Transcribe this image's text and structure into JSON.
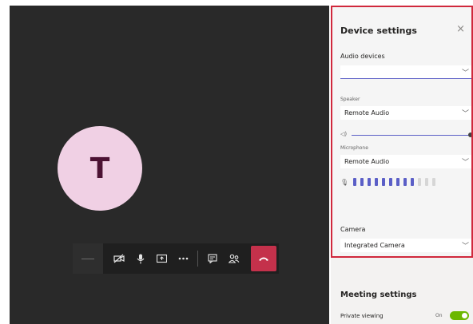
{
  "call": {
    "avatar_initial": "T"
  },
  "toolbar": {
    "buttons": [
      {
        "name": "video-off",
        "glyph": "▭̸"
      },
      {
        "name": "microphone",
        "glyph": "🎙"
      },
      {
        "name": "share-screen",
        "glyph": "⇪"
      },
      {
        "name": "more-actions",
        "glyph": "•••"
      },
      {
        "name": "chat",
        "glyph": "▤"
      },
      {
        "name": "participants",
        "glyph": "👥"
      }
    ]
  },
  "device_settings": {
    "title": "Device settings",
    "close_glyph": "×",
    "audio_devices_label": "Audio devices",
    "audio_device_value": "",
    "speaker_label": "Speaker",
    "speaker_value": "Remote Audio",
    "speaker_volume": 1.0,
    "microphone_label": "Microphone",
    "microphone_value": "Remote Audio",
    "mic_level_active_bars": 9,
    "mic_level_total_bars": 12,
    "camera_label": "Camera",
    "camera_value": "Integrated Camera"
  },
  "meeting_settings": {
    "title": "Meeting settings",
    "private_viewing_label": "Private viewing",
    "private_viewing_state": "On",
    "private_viewing_on": true
  },
  "colors": {
    "stage_bg": "#292929",
    "avatar_bg": "#f0d0e4",
    "hangup": "#c4314b",
    "accent": "#5b5fc7",
    "highlight": "#d0283c",
    "toggle_on": "#6bb700"
  }
}
